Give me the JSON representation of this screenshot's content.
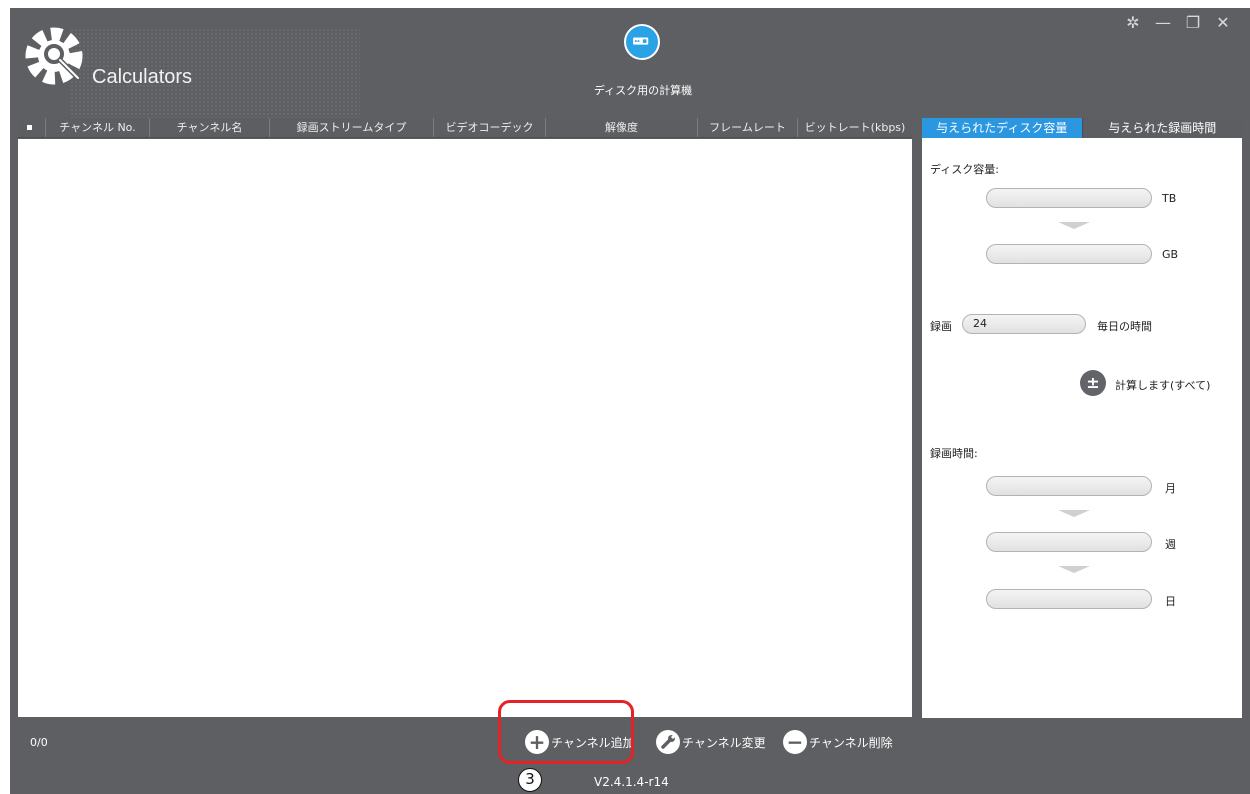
{
  "app": {
    "brand": "Calculators",
    "center_title": "ディスク用の計算機"
  },
  "window_controls": [
    "settings-icon",
    "minimize-icon",
    "restore-icon",
    "close-icon"
  ],
  "table": {
    "columns": [
      "チャンネル No.",
      "チャンネル名",
      "録画ストリームタイプ",
      "ビデオコーデック",
      "解像度",
      "フレームレート",
      "ビットレート(kbps)"
    ],
    "rows": []
  },
  "tabs": [
    "与えられたディスク容量",
    "与えられた録画時間"
  ],
  "side_panel": {
    "capacity_label": "ディスク容量:",
    "capacity_tb_value": "",
    "tb_unit": "TB",
    "capacity_gb_value": "",
    "gb_unit": "GB",
    "record_label": "録画",
    "record_hours_value": "24",
    "daily_hours_label": "毎日の時間",
    "calculate_label": "計算します(すべて)",
    "calculate_icon_text": "±",
    "record_time_label": "録画時間:",
    "month_value": "",
    "month_unit": "月",
    "week_value": "",
    "week_unit": "週",
    "day_value": "",
    "day_unit": "日"
  },
  "footer": {
    "count": "0/0",
    "add_channel": "チャンネル追加",
    "modify_channel": "チャンネル変更",
    "delete_channel": "チャンネル削除",
    "callout_number": "3",
    "version": "V2.4.1.4-r14"
  },
  "colors": {
    "app_background": "#5d5f62",
    "active_tab": "#2a97e0",
    "highlight": "#e52226"
  }
}
